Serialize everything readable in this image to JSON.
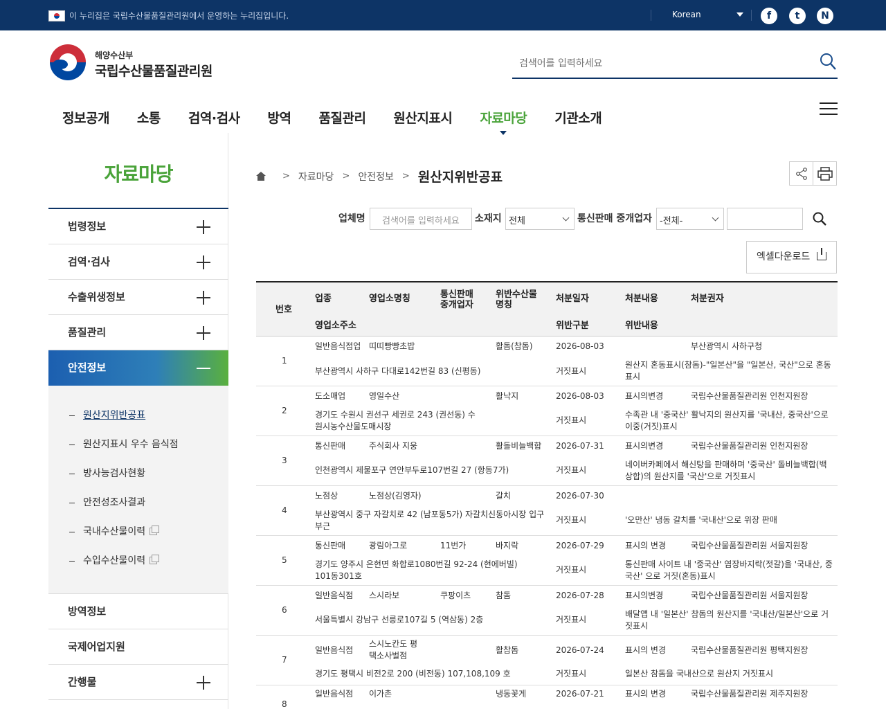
{
  "topbar": {
    "notice": "이 누리집은 국립수산물품질관리원에서 운영하는 누리집입니다.",
    "language": "Korean",
    "sns": [
      "facebook-icon",
      "twitter-icon",
      "naver-blog-icon"
    ]
  },
  "header": {
    "org_sub": "해양수산부",
    "org_name": "국립수산물품질관리원",
    "search_placeholder": "검색어를 입력하세요"
  },
  "gnb": [
    "정보공개",
    "소통",
    "검역·검사",
    "방역",
    "품질관리",
    "원산지표시",
    "자료마당",
    "기관소개"
  ],
  "gnb_active": "자료마당",
  "sidebar": {
    "title": "자료마당",
    "items": [
      "법령정보",
      "검역·검사",
      "수출위생정보",
      "품질관리",
      "안전정보"
    ],
    "sub_items": [
      "원산지위반공표",
      "원산지표시 우수 음식점",
      "방사능검사현황",
      "안전성조사결과",
      "국내수산물이력",
      "수입수산물이력"
    ],
    "items_after": [
      "방역정보",
      "국제어업지원",
      "간행물"
    ]
  },
  "breadcrumb": [
    "자료마당",
    "안전정보",
    "원산지위반공표"
  ],
  "filters": {
    "company_label": "업체명",
    "company_placeholder": "검색어를 입력하세요",
    "location_label": "소재지",
    "location_value": "전체",
    "broker_label": "통신판매 중개업자",
    "broker_value": "-전체-",
    "excel_label": "엑셀다운로드"
  },
  "table": {
    "headers": {
      "no": "번호",
      "type": "업종",
      "name": "영업소명칭",
      "broker_line1": "통신판매",
      "broker_line2": "중개업자",
      "product_line1": "위반수산물",
      "product_line2": "명칭",
      "date": "처분일자",
      "content": "처분내용",
      "authority": "처분권자",
      "address": "영업소주소",
      "category": "위반구분",
      "detail": "위반내용"
    },
    "rows": [
      {
        "no": "1",
        "type": "일반음식점업",
        "name": "띠띠빵빵초밥",
        "broker": "",
        "product": "활돔(참돔)",
        "date": "2026-08-03",
        "content": "",
        "authority": "부산광역시 사하구청",
        "address": "부산광역시 사하구 다대로142번길 83 (신평동)",
        "category": "거짓표시",
        "detail": "원산지 혼동표시(참돔)-\"일본산\"을 \"일본산, 국산\"으로 혼동표시"
      },
      {
        "no": "2",
        "type": "도소매업",
        "name": "영일수산",
        "broker": "",
        "product": "활낙지",
        "date": "2026-08-03",
        "content": "표시의변경",
        "authority": "국립수산물품질관리원 인천지원장",
        "address": "경기도 수원시 권선구 세권로 243 (권선동) 수원시농수산물도매시장",
        "category": "거짓표시",
        "detail": "수족관 내 '중국산' 활낙지의 원산지를 '국내산, 중국산'으로 이중(거짓)표시"
      },
      {
        "no": "3",
        "type": "통신판매",
        "name": "주식회사 지웅",
        "broker": "",
        "product": "활돌비늘백합",
        "date": "2026-07-31",
        "content": "표시의변경",
        "authority": "국립수산물품질관리원 인천지원장",
        "address": "인천광역시 제물포구 연안부두로107번길 27 (항동7가)",
        "category": "거짓표시",
        "detail": "네이버카페에서 해신탕을 판매하며 '중국산' 돌비늘백합(백상합)의 원산지를 '국산'으로 거짓표시"
      },
      {
        "no": "4",
        "type": "노점상",
        "name": "노점상(김영자)",
        "broker": "",
        "product": "갈치",
        "date": "2026-07-30",
        "content": "",
        "authority": "",
        "address": "부산광역시 중구 자갈치로 42 (남포동5가) 자갈치신동아시장 입구 부근",
        "category": "거짓표시",
        "detail": "'오만산' 냉동 갈치를 '국내산'으로 위장 판매"
      },
      {
        "no": "5",
        "type": "통신판매",
        "name": "광림아그로",
        "broker": "11번가",
        "product": "바지락",
        "date": "2026-07-29",
        "content": "표시의 변경",
        "authority": "국립수산물품질관리원 서울지원장",
        "address": "경기도 양주시 은현면 화합로1080번길 92-24 (현에버빌) 101동301호",
        "category": "거짓표시",
        "detail": "통신판매 사이트 내 '중국산' 염장바지락(젓갈)을 '국내산, 중국산' 으로 거짓(혼동)표시"
      },
      {
        "no": "6",
        "type": "일반음식점",
        "name": "스시라보",
        "broker": "쿠팡이츠",
        "product": "참돔",
        "date": "2026-07-28",
        "content": "표시의변경",
        "authority": "국립수산물품질관리원 서울지원장",
        "address": "서울특별시 강남구 선릉로107길 5 (역삼동) 2층",
        "category": "거짓표시",
        "detail": "배달앱 내 '일본산' 참돔의 원산지를 '국내산/일본산'으로 거짓표시"
      },
      {
        "no": "7",
        "type": "일반음식점",
        "name": "스시노칸도 평택소사벌점",
        "broker": "",
        "product": "활참돔",
        "date": "2026-07-24",
        "content": "표시의 변경",
        "authority": "국립수산물품질관리원 평택지원장",
        "address": "경기도 평택시 비전2로 200 (비전동) 107,108,109 호",
        "category": "거짓표시",
        "detail": "일본산 참돔을 국내산으로 원산지 거짓표시"
      },
      {
        "no": "8",
        "type": "일반음식점",
        "name": "이가촌",
        "broker": "",
        "product": "냉동꽃게",
        "date": "2026-07-21",
        "content": "표시의 변경",
        "authority": "국립수산물품질관리원 제주지원장",
        "address": "",
        "category": "",
        "detail": ""
      }
    ]
  }
}
